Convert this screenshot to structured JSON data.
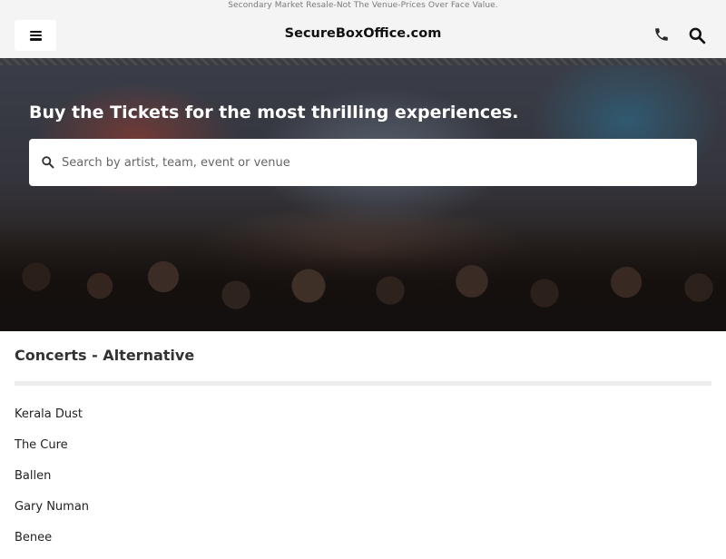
{
  "notice": "Secondary Market Resale-Not The Venue-Prices Over Face Value.",
  "header": {
    "title": "SecureBoxOffice.com",
    "menu_icon": "hamburger-menu-icon",
    "phone_icon": "phone-icon",
    "search_icon": "search-icon"
  },
  "hero": {
    "headline": "Buy the Tickets for the most thrilling experiences.",
    "search_placeholder": "Search by artist, team, event or venue",
    "search_value": ""
  },
  "section": {
    "title": "Concerts - Alternative",
    "items": [
      {
        "label": "Kerala Dust"
      },
      {
        "label": "The Cure"
      },
      {
        "label": "Ballen"
      },
      {
        "label": "Gary Numan"
      },
      {
        "label": "Benee"
      }
    ]
  },
  "colors": {
    "header_bg": "#f4f4f4",
    "text_dark": "#222222",
    "divider": "#ececec"
  }
}
